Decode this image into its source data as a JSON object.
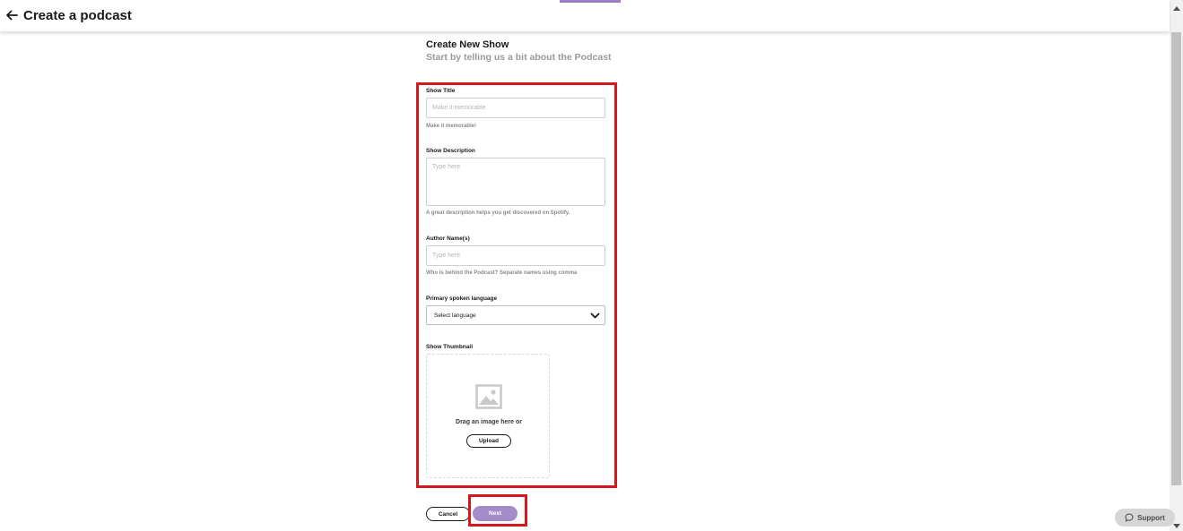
{
  "header": {
    "back_icon": "arrow-left-icon",
    "title": "Create a podcast"
  },
  "page": {
    "heading": "Create New Show",
    "subheading": "Start by telling us a bit about the Podcast"
  },
  "form": {
    "show_title": {
      "label": "Show Title",
      "placeholder": "Make it memorable",
      "hint": "Make it memorable!"
    },
    "show_description": {
      "label": "Show Description",
      "placeholder": "Type here",
      "hint": "A great description helps you get discovered on Spotify."
    },
    "author_names": {
      "label": "Author Name(s)",
      "placeholder": "Type here",
      "hint": "Who is behind the Podcast? Separate names using comma"
    },
    "language": {
      "label": "Primary spoken language",
      "selected": "Select language",
      "icon": "chevron-down-icon"
    },
    "thumbnail": {
      "label": "Show Thumbnail",
      "icon": "image-placeholder-icon",
      "drag_text": "Drag an image here or",
      "upload_label": "Upload"
    }
  },
  "actions": {
    "cancel_label": "Cancel",
    "next_label": "Next"
  },
  "support": {
    "label": "Support",
    "icon": "chat-bubble-icon"
  },
  "colors": {
    "accent": "#a58bc7",
    "highlight": "#d3191f",
    "progress": "#9d7cc4"
  }
}
